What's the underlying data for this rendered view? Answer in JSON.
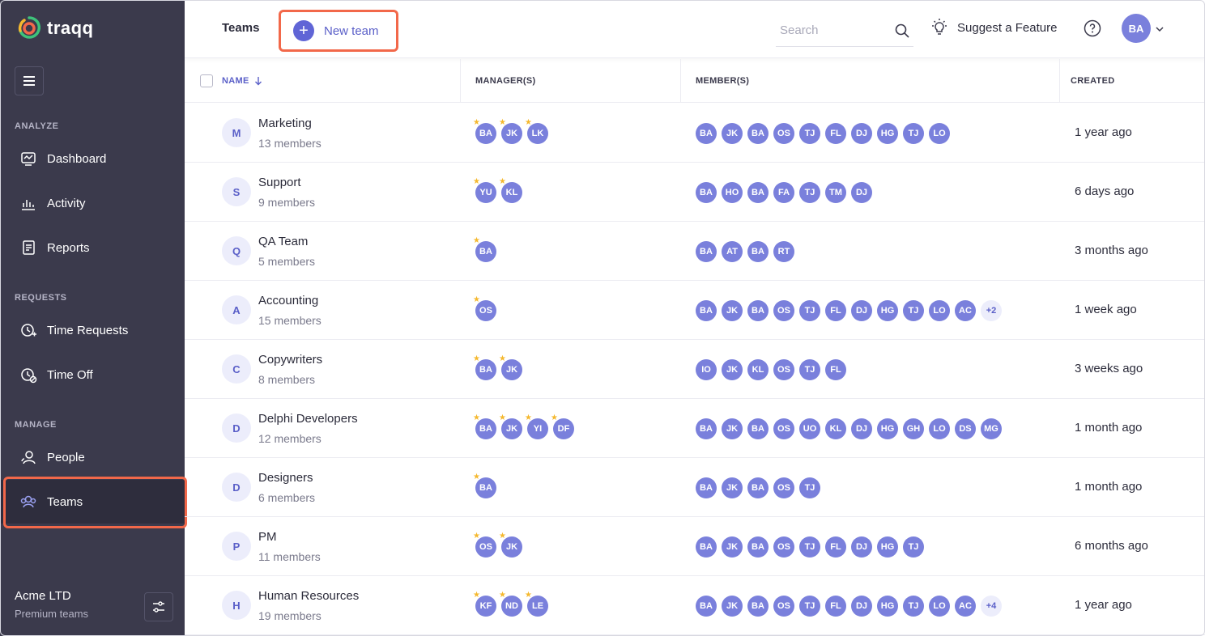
{
  "brand": {
    "name": "traqq"
  },
  "sidebar": {
    "sections": [
      {
        "label": "ANALYZE",
        "items": [
          {
            "label": "Dashboard",
            "icon": "dashboard-icon"
          },
          {
            "label": "Activity",
            "icon": "activity-icon"
          },
          {
            "label": "Reports",
            "icon": "reports-icon"
          }
        ]
      },
      {
        "label": "REQUESTS",
        "items": [
          {
            "label": "Time Requests",
            "icon": "time-requests-icon"
          },
          {
            "label": "Time Off",
            "icon": "time-off-icon"
          }
        ]
      },
      {
        "label": "MANAGE",
        "items": [
          {
            "label": "People",
            "icon": "people-icon"
          },
          {
            "label": "Teams",
            "icon": "teams-icon",
            "active": true
          }
        ]
      }
    ],
    "org": {
      "name": "Acme LTD",
      "plan": "Premium teams"
    }
  },
  "header": {
    "title": "Teams",
    "new_team_label": "New team",
    "search_placeholder": "Search",
    "suggest_label": "Suggest a Feature",
    "user_initials": "BA"
  },
  "colors": {
    "accent": "#5a5fc8",
    "avatar": "#7a80dc",
    "highlight": "#f2684a",
    "sidebar": "#3b3a4c",
    "star": "#f5b82e"
  },
  "table": {
    "columns": [
      "NAME",
      "MANAGER(S)",
      "MEMBER(S)",
      "CREATED"
    ],
    "rows": [
      {
        "initial": "M",
        "name": "Marketing",
        "count": "13 members",
        "managers": [
          "BA",
          "JK",
          "LK"
        ],
        "members": [
          "BA",
          "JK",
          "BA",
          "OS",
          "TJ",
          "FL",
          "DJ",
          "HG",
          "TJ",
          "LO"
        ],
        "more": "",
        "created": "1 year ago"
      },
      {
        "initial": "S",
        "name": "Support",
        "count": "9 members",
        "managers": [
          "YU",
          "KL"
        ],
        "members": [
          "BA",
          "HO",
          "BA",
          "FA",
          "TJ",
          "TM",
          "DJ"
        ],
        "more": "",
        "created": "6 days ago"
      },
      {
        "initial": "Q",
        "name": "QA Team",
        "count": "5 members",
        "managers": [
          "BA"
        ],
        "members": [
          "BA",
          "AT",
          "BA",
          "RT"
        ],
        "more": "",
        "created": "3 months ago"
      },
      {
        "initial": "A",
        "name": "Accounting",
        "count": "15 members",
        "managers": [
          "OS"
        ],
        "members": [
          "BA",
          "JK",
          "BA",
          "OS",
          "TJ",
          "FL",
          "DJ",
          "HG",
          "TJ",
          "LO",
          "AC"
        ],
        "more": "+2",
        "created": "1 week ago"
      },
      {
        "initial": "C",
        "name": "Copywriters",
        "count": "8 members",
        "managers": [
          "BA",
          "JK"
        ],
        "members": [
          "IO",
          "JK",
          "KL",
          "OS",
          "TJ",
          "FL"
        ],
        "more": "",
        "created": "3 weeks ago"
      },
      {
        "initial": "D",
        "name": "Delphi Developers",
        "count": "12 members",
        "managers": [
          "BA",
          "JK",
          "YI",
          "DF"
        ],
        "members": [
          "BA",
          "JK",
          "BA",
          "OS",
          "UO",
          "KL",
          "DJ",
          "HG",
          "GH",
          "LO",
          "DS",
          "MG"
        ],
        "more": "",
        "created": "1 month ago"
      },
      {
        "initial": "D",
        "name": "Designers",
        "count": "6 members",
        "managers": [
          "BA"
        ],
        "members": [
          "BA",
          "JK",
          "BA",
          "OS",
          "TJ"
        ],
        "more": "",
        "created": "1 month ago"
      },
      {
        "initial": "P",
        "name": "PM",
        "count": "11 members",
        "managers": [
          "OS",
          "JK"
        ],
        "members": [
          "BA",
          "JK",
          "BA",
          "OS",
          "TJ",
          "FL",
          "DJ",
          "HG",
          "TJ"
        ],
        "more": "",
        "created": "6 months ago"
      },
      {
        "initial": "H",
        "name": "Human Resources",
        "count": "19 members",
        "managers": [
          "KF",
          "ND",
          "LE"
        ],
        "members": [
          "BA",
          "JK",
          "BA",
          "OS",
          "TJ",
          "FL",
          "DJ",
          "HG",
          "TJ",
          "LO",
          "AC"
        ],
        "more": "+4",
        "created": "1 year ago"
      }
    ]
  }
}
